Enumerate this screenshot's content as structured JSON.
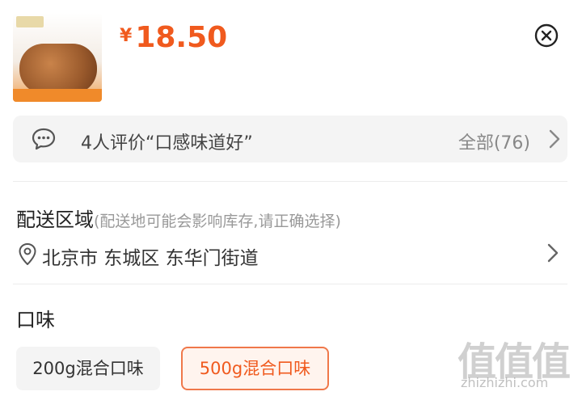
{
  "product": {
    "currency_symbol": "¥",
    "price": "18.50",
    "thumbnail_icon": "snack-product-image"
  },
  "close_icon": "close-circle-icon",
  "review": {
    "text": "4人评价“口感味道好”",
    "all_label": "全部(76)",
    "icon": "chat-bubble-icon"
  },
  "delivery": {
    "title": "配送区域",
    "hint": "(配送地可能会影响库存,请正确选择)",
    "address": "北京市 东城区 东华门街道",
    "icon": "location-pin-icon"
  },
  "flavor": {
    "title": "口味",
    "options": [
      {
        "label": "200g混合口味",
        "selected": false
      },
      {
        "label": "500g混合口味",
        "selected": true
      }
    ]
  },
  "watermark": {
    "glyphs": "值值值",
    "url": "zhizhizhi.com"
  },
  "colors": {
    "accent": "#f05a1e",
    "muted": "#999999",
    "panel": "#f4f4f4"
  }
}
